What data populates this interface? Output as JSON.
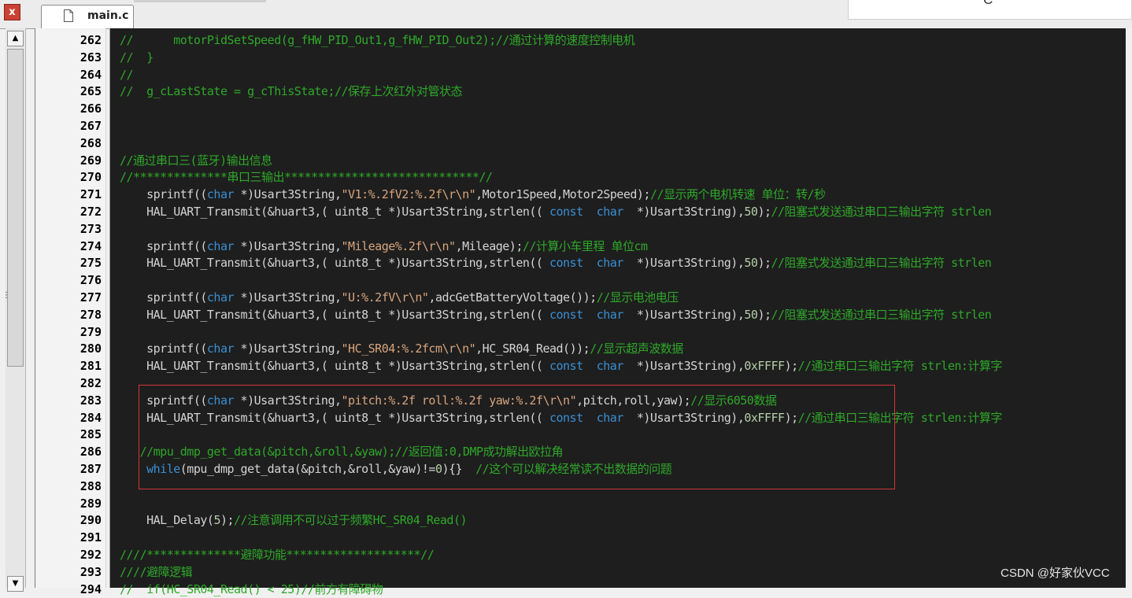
{
  "tab": {
    "filename": "main.c",
    "close_glyph": "x"
  },
  "popup_text": "C",
  "watermark": "CSDN @好家伙VCC",
  "colors": {
    "comment": "#2fa829",
    "keyword": "#3a8fd3",
    "string": "#d8a57d",
    "number": "#b5cea8",
    "text": "#d4d4d4",
    "background": "#1e1e1e",
    "highlight_box": "#d33636"
  },
  "lines": [
    {
      "n": "262",
      "tokens": [
        [
          "cm",
          "//      motorPidSetSpeed(g_fHW_PID_Out1,g_fHW_PID_Out2);//通过计算的速度控制电机"
        ]
      ]
    },
    {
      "n": "263",
      "tokens": [
        [
          "cm",
          "//  }"
        ]
      ]
    },
    {
      "n": "264",
      "tokens": [
        [
          "cm",
          "//"
        ]
      ]
    },
    {
      "n": "265",
      "tokens": [
        [
          "cm",
          "//  g_cLastState = g_cThisState;//保存上次红外对管状态"
        ]
      ]
    },
    {
      "n": "266",
      "tokens": []
    },
    {
      "n": "267",
      "tokens": []
    },
    {
      "n": "268",
      "tokens": []
    },
    {
      "n": "269",
      "tokens": [
        [
          "cm",
          "//通过串口三(蓝牙)输出信息"
        ]
      ]
    },
    {
      "n": "270",
      "tokens": [
        [
          "cm",
          "//**************串口三输出*****************************//"
        ]
      ]
    },
    {
      "n": "271",
      "tokens": [
        [
          "tx",
          "    sprintf(("
        ],
        [
          "kw",
          "char"
        ],
        [
          "tx",
          " *)Usart3String,"
        ],
        [
          "st",
          "\"V1:%.2fV2:%.2f\\r\\n\""
        ],
        [
          "tx",
          ",Motor1Speed,Motor2Speed);"
        ],
        [
          "cm",
          "//显示两个电机转速 单位：转/秒"
        ]
      ]
    },
    {
      "n": "272",
      "tokens": [
        [
          "tx",
          "    HAL_UART_Transmit(&huart3,( uint8_t *)Usart3String,strlen(( "
        ],
        [
          "kw",
          "const"
        ],
        [
          "tx",
          "  "
        ],
        [
          "kw",
          "char"
        ],
        [
          "tx",
          "  *)Usart3String),"
        ],
        [
          "nm",
          "50"
        ],
        [
          "tx",
          ");"
        ],
        [
          "cm",
          "//阻塞式发送通过串口三输出字符 strlen"
        ]
      ]
    },
    {
      "n": "273",
      "tokens": []
    },
    {
      "n": "274",
      "tokens": [
        [
          "tx",
          "    sprintf(("
        ],
        [
          "kw",
          "char"
        ],
        [
          "tx",
          " *)Usart3String,"
        ],
        [
          "st",
          "\"Mileage%.2f\\r\\n\""
        ],
        [
          "tx",
          ",Mileage);"
        ],
        [
          "cm",
          "//计算小车里程 单位cm"
        ]
      ]
    },
    {
      "n": "275",
      "tokens": [
        [
          "tx",
          "    HAL_UART_Transmit(&huart3,( uint8_t *)Usart3String,strlen(( "
        ],
        [
          "kw",
          "const"
        ],
        [
          "tx",
          "  "
        ],
        [
          "kw",
          "char"
        ],
        [
          "tx",
          "  *)Usart3String),"
        ],
        [
          "nm",
          "50"
        ],
        [
          "tx",
          ");"
        ],
        [
          "cm",
          "//阻塞式发送通过串口三输出字符 strlen"
        ]
      ]
    },
    {
      "n": "276",
      "tokens": []
    },
    {
      "n": "277",
      "tokens": [
        [
          "tx",
          "    sprintf(("
        ],
        [
          "kw",
          "char"
        ],
        [
          "tx",
          " *)Usart3String,"
        ],
        [
          "st",
          "\"U:%.2fV\\r\\n\""
        ],
        [
          "tx",
          ",adcGetBatteryVoltage());"
        ],
        [
          "cm",
          "//显示电池电压"
        ]
      ]
    },
    {
      "n": "278",
      "tokens": [
        [
          "tx",
          "    HAL_UART_Transmit(&huart3,( uint8_t *)Usart3String,strlen(( "
        ],
        [
          "kw",
          "const"
        ],
        [
          "tx",
          "  "
        ],
        [
          "kw",
          "char"
        ],
        [
          "tx",
          "  *)Usart3String),"
        ],
        [
          "nm",
          "50"
        ],
        [
          "tx",
          ");"
        ],
        [
          "cm",
          "//阻塞式发送通过串口三输出字符 strlen"
        ]
      ]
    },
    {
      "n": "279",
      "tokens": []
    },
    {
      "n": "280",
      "tokens": [
        [
          "tx",
          "    sprintf(("
        ],
        [
          "kw",
          "char"
        ],
        [
          "tx",
          " *)Usart3String,"
        ],
        [
          "st",
          "\"HC_SR04:%.2fcm\\r\\n\""
        ],
        [
          "tx",
          ",HC_SR04_Read());"
        ],
        [
          "cm",
          "//显示超声波数据"
        ]
      ]
    },
    {
      "n": "281",
      "tokens": [
        [
          "tx",
          "    HAL_UART_Transmit(&huart3,( uint8_t *)Usart3String,strlen(( "
        ],
        [
          "kw",
          "const"
        ],
        [
          "tx",
          "  "
        ],
        [
          "kw",
          "char"
        ],
        [
          "tx",
          "  *)Usart3String),"
        ],
        [
          "nm",
          "0xFFFF"
        ],
        [
          "tx",
          ");"
        ],
        [
          "cm",
          "//通过串口三输出字符 strlen:计算字"
        ]
      ]
    },
    {
      "n": "282",
      "tokens": []
    },
    {
      "n": "283",
      "tokens": [
        [
          "tx",
          "    sprintf(("
        ],
        [
          "kw",
          "char"
        ],
        [
          "tx",
          " *)Usart3String,"
        ],
        [
          "st",
          "\"pitch:%.2f roll:%.2f yaw:%.2f\\r\\n\""
        ],
        [
          "tx",
          ",pitch,roll,yaw);"
        ],
        [
          "cm",
          "//显示6050数据"
        ]
      ]
    },
    {
      "n": "284",
      "tokens": [
        [
          "tx",
          "    HAL_UART_Transmit(&huart3,( uint8_t *)Usart3String,strlen(( "
        ],
        [
          "kw",
          "const"
        ],
        [
          "tx",
          "  "
        ],
        [
          "kw",
          "char"
        ],
        [
          "tx",
          "  *)Usart3String),"
        ],
        [
          "nm",
          "0xFFFF"
        ],
        [
          "tx",
          ");"
        ],
        [
          "cm",
          "//通过串口三输出字符 strlen:计算字"
        ]
      ]
    },
    {
      "n": "285",
      "tokens": []
    },
    {
      "n": "286",
      "tokens": [
        [
          "cm",
          "   //mpu_dmp_get_data(&pitch,&roll,&yaw);//返回值:0,DMP成功解出欧拉角"
        ]
      ]
    },
    {
      "n": "287",
      "tokens": [
        [
          "tx",
          "    "
        ],
        [
          "kw",
          "while"
        ],
        [
          "tx",
          "(mpu_dmp_get_data(&pitch,&roll,&yaw)!="
        ],
        [
          "nm",
          "0"
        ],
        [
          "tx",
          "){}  "
        ],
        [
          "cm",
          "//这个可以解决经常读不出数据的问题"
        ]
      ]
    },
    {
      "n": "288",
      "tokens": []
    },
    {
      "n": "289",
      "tokens": []
    },
    {
      "n": "290",
      "tokens": [
        [
          "tx",
          "    HAL_Delay("
        ],
        [
          "nm",
          "5"
        ],
        [
          "tx",
          ");"
        ],
        [
          "cm",
          "//注意调用不可以过于频繁HC_SR04_Read()"
        ]
      ]
    },
    {
      "n": "291",
      "tokens": []
    },
    {
      "n": "292",
      "tokens": [
        [
          "cm",
          "////**************避障功能********************//"
        ]
      ]
    },
    {
      "n": "293",
      "tokens": [
        [
          "cm",
          "////避障逻辑"
        ]
      ]
    },
    {
      "n": "294",
      "tokens": [
        [
          "cm",
          "//  if(HC_SR04_Read() < 25)//前方有障碍物"
        ]
      ]
    }
  ]
}
